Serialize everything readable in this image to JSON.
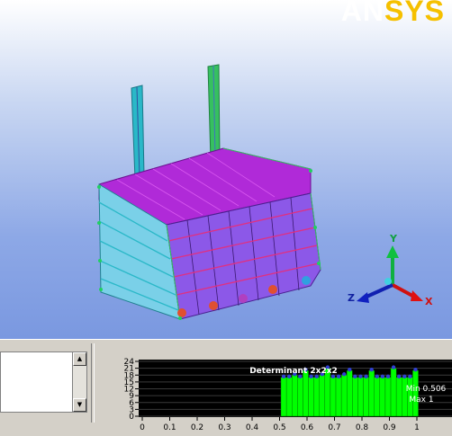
{
  "logo": {
    "text_an": "AN",
    "text_sys": "SYS"
  },
  "triad": {
    "y": "Y",
    "x": "X",
    "z": "Z"
  },
  "colors": {
    "mesh_magenta": "#b02ad8",
    "mesh_purple": "#8c58e8",
    "mesh_cyan": "#2ab8c8",
    "mesh_green": "#36c060",
    "chart_green": "#00ff00",
    "chart_bg": "#000000"
  },
  "message_panel": {
    "scroll_up_icon": "up-arrow-icon",
    "scroll_down_icon": "down-arrow-icon"
  },
  "chart_data": {
    "type": "bar",
    "title": "Determinant 2x2x2",
    "annotations": [
      "Min 0.506",
      "Max 1"
    ],
    "x_ticks": [
      "0",
      "0.1",
      "0.2",
      "0.3",
      "0.4",
      "0.5",
      "0.6",
      "0.7",
      "0.8",
      "0.9",
      "1"
    ],
    "y_ticks": [
      "0",
      "3",
      "6",
      "9",
      "12",
      "15",
      "18",
      "21",
      "24"
    ],
    "xlim": [
      0,
      1
    ],
    "ylim": [
      0,
      24
    ],
    "x": [
      0.515,
      0.535,
      0.555,
      0.575,
      0.595,
      0.615,
      0.635,
      0.655,
      0.675,
      0.695,
      0.715,
      0.735,
      0.755,
      0.775,
      0.795,
      0.815,
      0.835,
      0.855,
      0.875,
      0.895,
      0.915,
      0.935,
      0.955,
      0.975,
      0.995
    ],
    "values": [
      17,
      17,
      18,
      17,
      20,
      17,
      17,
      18,
      21,
      17,
      17,
      18,
      20,
      17,
      17,
      17,
      20,
      17,
      17,
      17,
      21,
      17,
      17,
      17,
      20
    ]
  }
}
